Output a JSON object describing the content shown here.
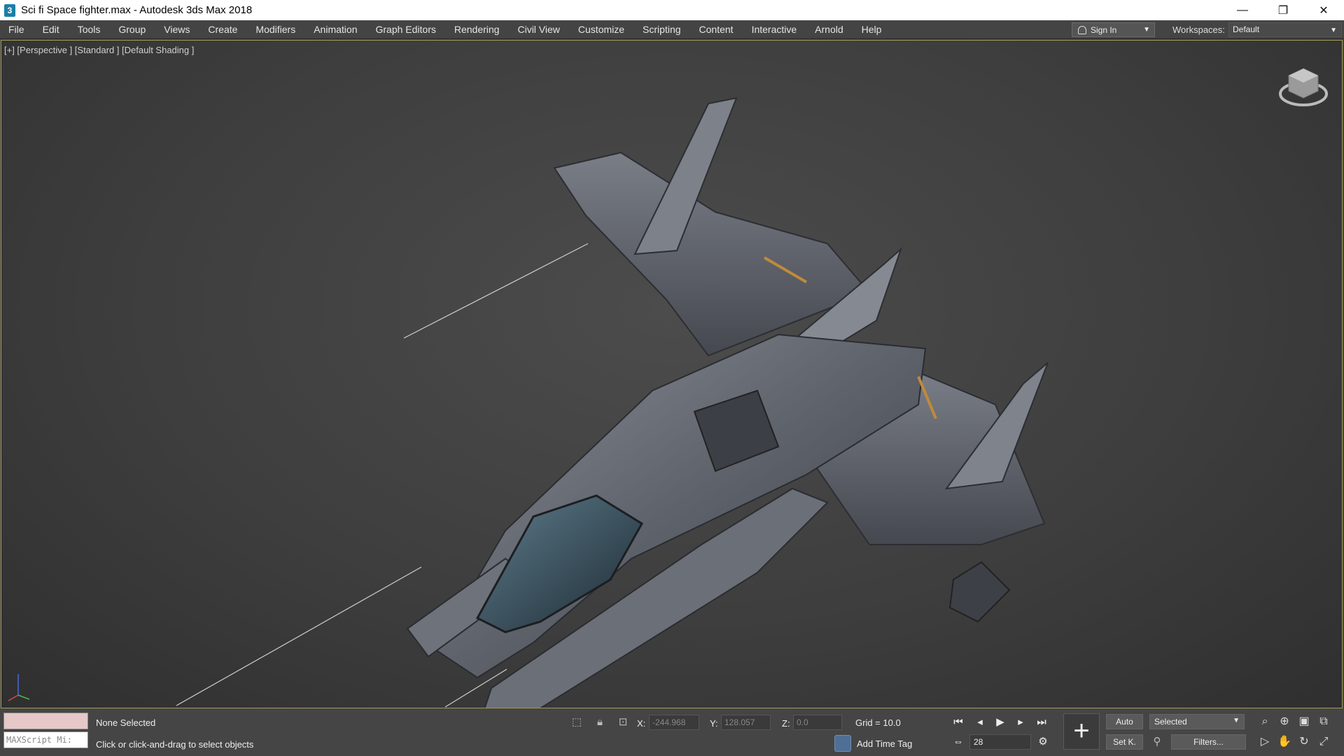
{
  "window": {
    "title": "Sci fi Space fighter.max - Autodesk 3ds Max 2018",
    "app_icon": "3",
    "controls": {
      "minimize": "—",
      "restore": "❐",
      "close": "✕"
    }
  },
  "menu": {
    "items": [
      "File",
      "Edit",
      "Tools",
      "Group",
      "Views",
      "Create",
      "Modifiers",
      "Animation",
      "Graph Editors",
      "Rendering",
      "Civil View",
      "Customize",
      "Scripting",
      "Content",
      "Interactive",
      "Arnold",
      "Help"
    ],
    "sign_in": "Sign In",
    "workspaces_label": "Workspaces:",
    "workspace_value": "Default"
  },
  "viewport": {
    "label": "[+] [Perspective ] [Standard ] [Default Shading ]",
    "border_color": "#a39a57"
  },
  "status": {
    "maxscript_placeholder": "MAXScript Mi:",
    "selection": "None Selected",
    "prompt": "Click or click-and-drag to select objects",
    "x_label": "X:",
    "x_value": "-244.968",
    "y_label": "Y:",
    "y_value": "128.057",
    "z_label": "Z:",
    "z_value": "0.0",
    "grid": "Grid = 10.0",
    "add_time_tag": "Add Time Tag",
    "current_frame": "28",
    "auto_key": "Auto",
    "set_key": "Set K.",
    "key_filter_value": "Selected",
    "filters": "Filters..."
  }
}
